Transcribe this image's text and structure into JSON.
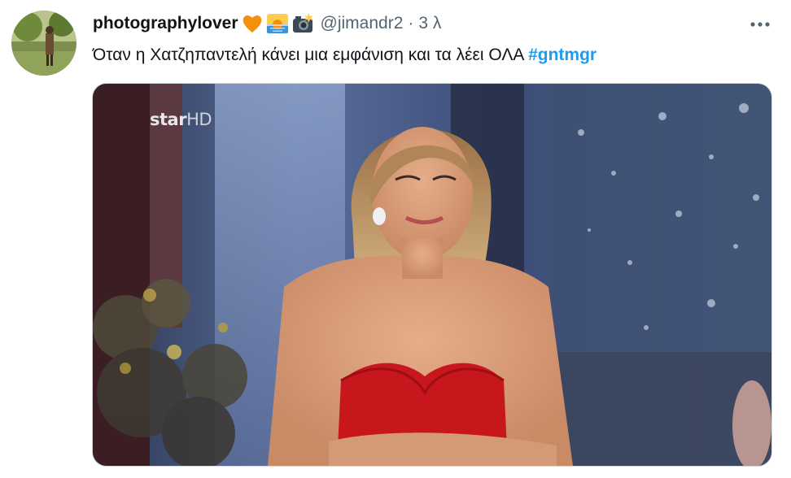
{
  "tweet": {
    "display_name": "photographylover",
    "emojis": [
      "orange-heart-icon",
      "sunrise-icon",
      "camera-flash-icon"
    ],
    "handle": "@jimandr2",
    "separator": "·",
    "time": "3 λ",
    "text": "Όταν η Χατζηπαντελή κάνει μια εμφάνιση και τα λέει ΟΛΑ",
    "hashtag": "#gntmgr",
    "more_icon": "more-dots-icon"
  },
  "media": {
    "channel_logo": "star",
    "channel_logo_suffix": "HD"
  },
  "colors": {
    "link": "#1d9bf0",
    "secondary_text": "#536471",
    "dress": "#c8161d"
  }
}
